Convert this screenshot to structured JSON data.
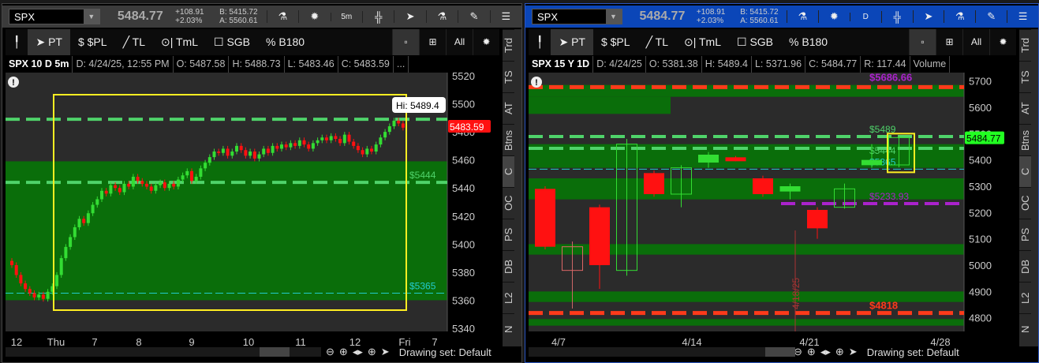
{
  "panels": [
    {
      "id": "left",
      "symbol": "SPX",
      "last": "5484.77",
      "change": "+108.91",
      "change_pct": "+2.03%",
      "bid": "B: 5415.72",
      "ask": "A: 5560.61",
      "timeframe_btn": "5m",
      "tools": [
        "PT",
        "$PL",
        "TL",
        "TmL",
        "SGB",
        "B180"
      ],
      "info": [
        "SPX 10 D 5m",
        "D: 4/24/25, 12:55 PM",
        "O: 5487.58",
        "H: 5488.73",
        "L: 5483.46",
        "C: 5483.59",
        "..."
      ],
      "drawing_set": "Drawing set: Default"
    },
    {
      "id": "right",
      "symbol": "SPX",
      "last": "5484.77",
      "change": "+108.91",
      "change_pct": "+2.03%",
      "bid": "B: 5415.72",
      "ask": "A: 5560.61",
      "timeframe_btn": "D",
      "tools": [
        "PT",
        "$PL",
        "TL",
        "TmL",
        "SGB",
        "B180"
      ],
      "info": [
        "SPX 15 Y 1D",
        "D: 4/24/25",
        "O: 5381.38",
        "H: 5489.4",
        "L: 5371.96",
        "C: 5484.77",
        "R: 117.44",
        "Volume"
      ],
      "drawing_set": "Drawing set: Default"
    }
  ],
  "side_tabs": [
    "Trd",
    "TS",
    "AT",
    "Btns",
    "C",
    "OC",
    "PS",
    "DB",
    "L2",
    "N"
  ],
  "active_side_tab": "C",
  "colors": {
    "green_zone": "#0a6e0a",
    "up": "#33dd33",
    "down": "#ff1111",
    "level": "#4fd36a",
    "cyan": "#22cccc",
    "purple": "#aa22cc",
    "red_level": "#ff3a1a",
    "box": "#ffee22"
  },
  "chart_data": [
    {
      "type": "candlestick",
      "name": "SPX 10 D 5m",
      "ylim": [
        5340,
        5520
      ],
      "yticks": [
        5520,
        5500,
        5480,
        5460,
        5440,
        5420,
        5400,
        5380,
        5360,
        5340
      ],
      "xticks": [
        "12",
        "Thu",
        "7",
        "8",
        "9",
        "10",
        "11",
        "12",
        "Fri",
        "7"
      ],
      "closes": [
        5385,
        5378,
        5372,
        5368,
        5365,
        5362,
        5364,
        5361,
        5366,
        5370,
        5378,
        5390,
        5398,
        5405,
        5412,
        5418,
        5415,
        5422,
        5428,
        5432,
        5438,
        5436,
        5442,
        5440,
        5437,
        5443,
        5441,
        5448,
        5445,
        5443,
        5441,
        5438,
        5442,
        5444,
        5440,
        5443,
        5441,
        5446,
        5449,
        5452,
        5445,
        5448,
        5454,
        5458,
        5462,
        5466,
        5465,
        5468,
        5463,
        5466,
        5470,
        5467,
        5463,
        5466,
        5461,
        5464,
        5468,
        5465,
        5470,
        5468,
        5471,
        5469,
        5472,
        5470,
        5474,
        5471,
        5468,
        5472,
        5474,
        5476,
        5474,
        5477,
        5475,
        5472,
        5478,
        5473,
        5470,
        5467,
        5464,
        5468,
        5466,
        5471,
        5476,
        5480,
        5484,
        5488,
        5486,
        5483
      ],
      "zones": [
        [
          5360,
          5459
        ]
      ],
      "levels": [
        {
          "price": 5489,
          "label": "",
          "color": "level"
        },
        {
          "price": 5444,
          "label": "$5444",
          "color": "level"
        },
        {
          "price": 5365,
          "label": "$5365",
          "color": "cyan"
        }
      ],
      "last_price": "5483.59",
      "hi_label": "Hi: 5489.4"
    },
    {
      "type": "candlestick",
      "name": "SPX 15 Y 1D",
      "ylim": [
        4760,
        5720
      ],
      "yticks": [
        5700,
        5600,
        5500,
        5400,
        5300,
        5200,
        5100,
        5000,
        4900,
        4800
      ],
      "xticks": [
        "4/7",
        "4/14",
        "4/21",
        "4/28"
      ],
      "ohlc": [
        [
          5290,
          5300,
          5060,
          5070
        ],
        [
          5070,
          5090,
          4835,
          4980
        ],
        [
          5220,
          5230,
          4910,
          5000
        ],
        [
          4980,
          5480,
          4960,
          5460
        ],
        [
          5350,
          5360,
          5260,
          5270
        ],
        [
          5270,
          5380,
          5220,
          5370
        ],
        [
          5390,
          5430,
          5370,
          5420
        ],
        [
          5410,
          5415,
          5395,
          5395
        ],
        [
          5330,
          5340,
          5260,
          5270
        ],
        [
          5280,
          5310,
          5250,
          5300
        ],
        [
          5210,
          5220,
          5100,
          5140
        ],
        [
          5220,
          5310,
          5215,
          5290
        ],
        [
          5380,
          5460,
          5370,
          5400
        ],
        [
          5381,
          5489,
          5372,
          5485
        ]
      ],
      "zones": [
        [
          5640,
          5685
        ],
        [
          5370,
          5460
        ],
        [
          5250,
          5330
        ],
        [
          5040,
          5080
        ],
        [
          4860,
          4900
        ],
        [
          4770,
          4795
        ]
      ],
      "levels": [
        {
          "price": 5677,
          "label": "$5686.66",
          "color": "red_level",
          "labelcolor": "purple"
        },
        {
          "price": 5489,
          "label": "$5489",
          "color": "level"
        },
        {
          "price": 5444,
          "label": "$5444",
          "color": "level"
        },
        {
          "price": 5365,
          "label": "$5365",
          "color": "cyan"
        },
        {
          "price": 5234,
          "label": "$5233.93",
          "color": "purple"
        },
        {
          "price": 4818,
          "label": "$4818",
          "color": "red_level"
        }
      ],
      "vertical_label": "4/18/25",
      "last_price": "5484.77"
    }
  ]
}
